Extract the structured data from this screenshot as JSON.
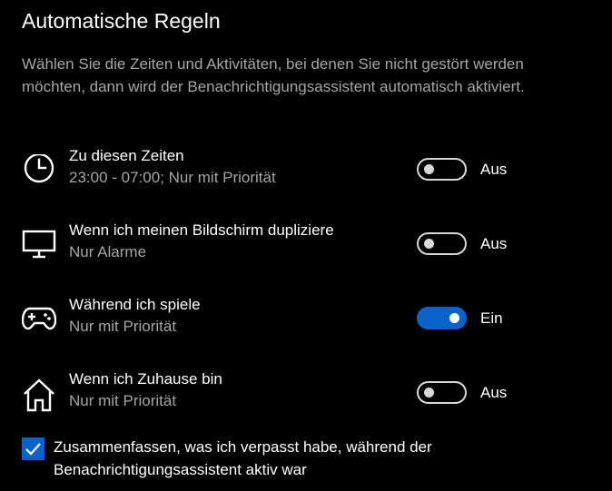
{
  "page": {
    "title": "Automatische Regeln",
    "description": "Wählen Sie die Zeiten und Aktivitäten, bei denen Sie nicht gestört werden möchten, dann wird der Benachrichtigungsassistent automatisch aktiviert."
  },
  "rules": [
    {
      "icon": "clock-icon",
      "title": "Zu diesen Zeiten",
      "subtitle": "23:00 - 07:00; Nur mit Priorität",
      "enabled": false,
      "state_label": "Aus"
    },
    {
      "icon": "monitor-icon",
      "title": "Wenn ich meinen Bildschirm dupliziere",
      "subtitle": "Nur Alarme",
      "enabled": false,
      "state_label": "Aus"
    },
    {
      "icon": "gamepad-icon",
      "title": "Während ich spiele",
      "subtitle": "Nur mit Priorität",
      "enabled": true,
      "state_label": "Ein"
    },
    {
      "icon": "home-icon",
      "title": "Wenn ich Zuhause bin",
      "subtitle": "Nur mit Priorität",
      "enabled": false,
      "state_label": "Aus"
    }
  ],
  "summary_checkbox": {
    "checked": true,
    "label": "Zusammenfassen, was ich verpasst habe, während der Benachrichtigungsassistent aktiv war"
  },
  "colors": {
    "background": "#000000",
    "accent": "#0b63c9",
    "text_primary": "#ffffff",
    "text_secondary": "#a6a6a6",
    "toggle_off_border": "#d8d8d8"
  }
}
